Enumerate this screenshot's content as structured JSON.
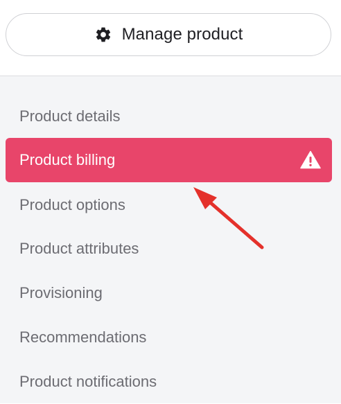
{
  "header": {
    "manage_button": {
      "label": "Manage product",
      "icon": "gear-icon"
    }
  },
  "sidebar": {
    "items": [
      {
        "label": "Product details",
        "active": false
      },
      {
        "label": "Product billing",
        "active": true,
        "status_icon": "warning-icon"
      },
      {
        "label": "Product options",
        "active": false
      },
      {
        "label": "Product attributes",
        "active": false
      },
      {
        "label": "Provisioning",
        "active": false
      },
      {
        "label": "Recommendations",
        "active": false
      },
      {
        "label": "Product notifications",
        "active": false
      }
    ]
  },
  "colors": {
    "active_bg": "#e8456a",
    "active_text": "#ffffff",
    "inactive_text": "#6c6c72",
    "sidebar_bg": "#f4f5f7",
    "annotation_arrow": "#e4312b"
  }
}
